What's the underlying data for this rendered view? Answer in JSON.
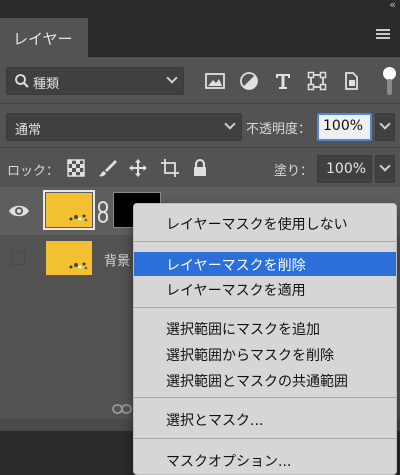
{
  "window": {
    "collapse_glyph": "‹‹"
  },
  "tab": {
    "label": "レイヤー"
  },
  "filter": {
    "kind_label": "種類",
    "icons": [
      "image-filter-icon",
      "adjustment-filter-icon",
      "type-filter-icon",
      "shape-filter-icon",
      "smart-object-filter-icon"
    ]
  },
  "blend": {
    "mode": "通常",
    "opacity_label": "不透明度：",
    "opacity_value": "100%"
  },
  "lock": {
    "label": "ロック：",
    "fill_label": "塗り：",
    "fill_value": "100%"
  },
  "layers": [
    {
      "name": "",
      "visible": true,
      "has_mask": true,
      "selected": true
    },
    {
      "name": "背景",
      "visible": false,
      "has_mask": false,
      "selected": false
    }
  ],
  "context_menu": {
    "items": [
      "レイヤーマスクを使用しない",
      "レイヤーマスクを削除",
      "レイヤーマスクを適用",
      "選択範囲にマスクを追加",
      "選択範囲からマスクを削除",
      "選択範囲とマスクの共通範囲",
      "選択とマスク...",
      "マスクオプション..."
    ],
    "highlighted_index": 1,
    "highlight_color": "#2d6fd8"
  },
  "colors": {
    "panel": "#535353",
    "thumbnail": "#f2c030",
    "accent": "#4d8bd6"
  }
}
